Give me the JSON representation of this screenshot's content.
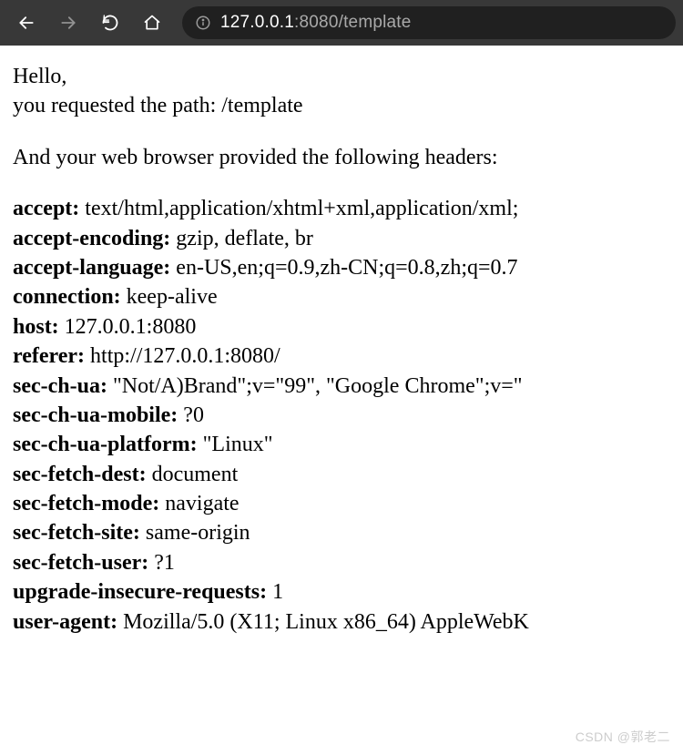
{
  "url": {
    "host": "127.0.0.1",
    "port": ":8080",
    "path": "/template"
  },
  "page": {
    "greeting": "Hello,",
    "requested_prefix": "you requested the path: ",
    "requested_path": "/template",
    "headers_intro": "And your web browser provided the following headers:",
    "headers": [
      {
        "name": "accept",
        "value": "text/html,application/xhtml+xml,application/xml;"
      },
      {
        "name": "accept-encoding",
        "value": "gzip, deflate, br"
      },
      {
        "name": "accept-language",
        "value": "en-US,en;q=0.9,zh-CN;q=0.8,zh;q=0.7"
      },
      {
        "name": "connection",
        "value": "keep-alive"
      },
      {
        "name": "host",
        "value": "127.0.0.1:8080"
      },
      {
        "name": "referer",
        "value": "http://127.0.0.1:8080/"
      },
      {
        "name": "sec-ch-ua",
        "value": "\"Not/A)Brand\";v=\"99\", \"Google Chrome\";v=\""
      },
      {
        "name": "sec-ch-ua-mobile",
        "value": "?0"
      },
      {
        "name": "sec-ch-ua-platform",
        "value": "\"Linux\""
      },
      {
        "name": "sec-fetch-dest",
        "value": "document"
      },
      {
        "name": "sec-fetch-mode",
        "value": "navigate"
      },
      {
        "name": "sec-fetch-site",
        "value": "same-origin"
      },
      {
        "name": "sec-fetch-user",
        "value": "?1"
      },
      {
        "name": "upgrade-insecure-requests",
        "value": "1"
      },
      {
        "name": "user-agent",
        "value": "Mozilla/5.0 (X11; Linux x86_64) AppleWebK"
      }
    ]
  },
  "watermark": "CSDN @郭老二"
}
